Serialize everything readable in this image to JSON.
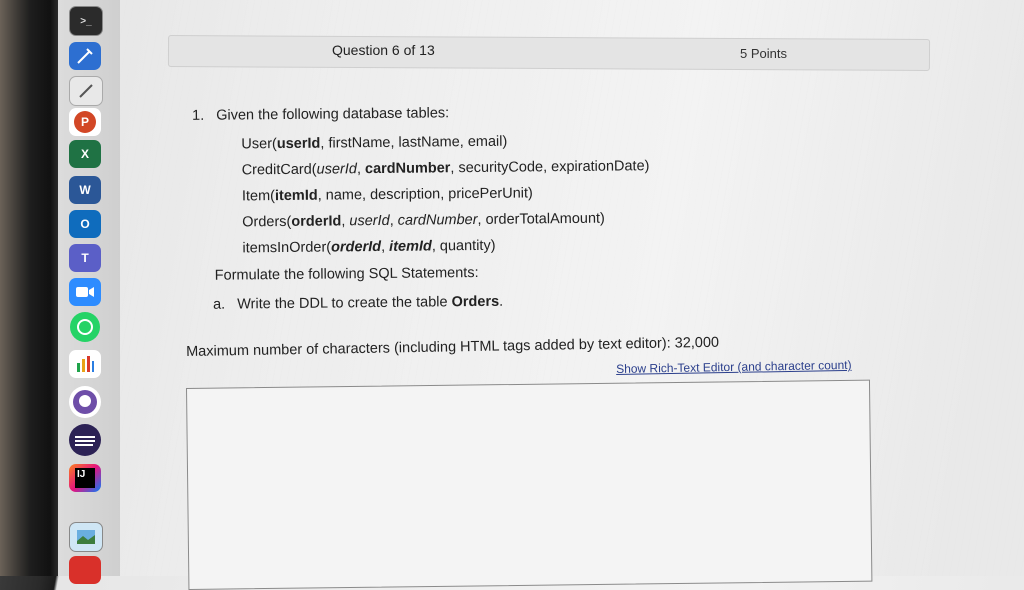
{
  "question": {
    "header": "Question 6 of 13",
    "points": "5 Points"
  },
  "prompt": {
    "intro_number": "1.",
    "intro": "Given the following database tables:",
    "tables": {
      "user": {
        "name": "User(",
        "key": "userId",
        "rest": ", firstName, lastName, email)"
      },
      "creditcard": {
        "name": "CreditCard(",
        "fk": "userId",
        "sep1": ", ",
        "key": "cardNumber",
        "rest": ", securityCode, expirationDate)"
      },
      "item": {
        "name": "Item(",
        "key": "itemId",
        "rest": ", name, description, pricePerUnit)"
      },
      "orders": {
        "name": "Orders(",
        "key": "orderId",
        "sep1": ", ",
        "fk1": "userId",
        "sep2": ", ",
        "fk2": "cardNumber",
        "rest": ", orderTotalAmount)"
      },
      "itemsinorder": {
        "name": "itemsInOrder(",
        "key1": "orderId",
        "sep1": ", ",
        "key2": "itemId",
        "rest": ", quantity)"
      }
    },
    "formulate": "Formulate the following SQL Statements:",
    "part_a_label": "a.",
    "part_a_text": "Write the DDL to create the table ",
    "part_a_bold": "Orders",
    "part_a_end": "."
  },
  "editor": {
    "max_chars": "Maximum number of characters (including HTML tags added by text editor): 32,000",
    "rich_text_link": "Show Rich-Text Editor (and character count)"
  },
  "dock": {
    "items": [
      "terminal-icon",
      "xcode-icon",
      "textedit-icon",
      "powerpoint-icon",
      "excel-icon",
      "word-icon",
      "outlook-icon",
      "teams-icon",
      "zoom-icon",
      "whatsapp-icon",
      "numbers-icon",
      "github-icon",
      "eclipse-icon",
      "intellij-icon",
      "preview-icon",
      "app-icon"
    ],
    "labels": {
      "powerpoint": "P",
      "excel": "X",
      "word": "W",
      "outlook": "O",
      "teams": "T",
      "intellij": "IJ"
    }
  }
}
